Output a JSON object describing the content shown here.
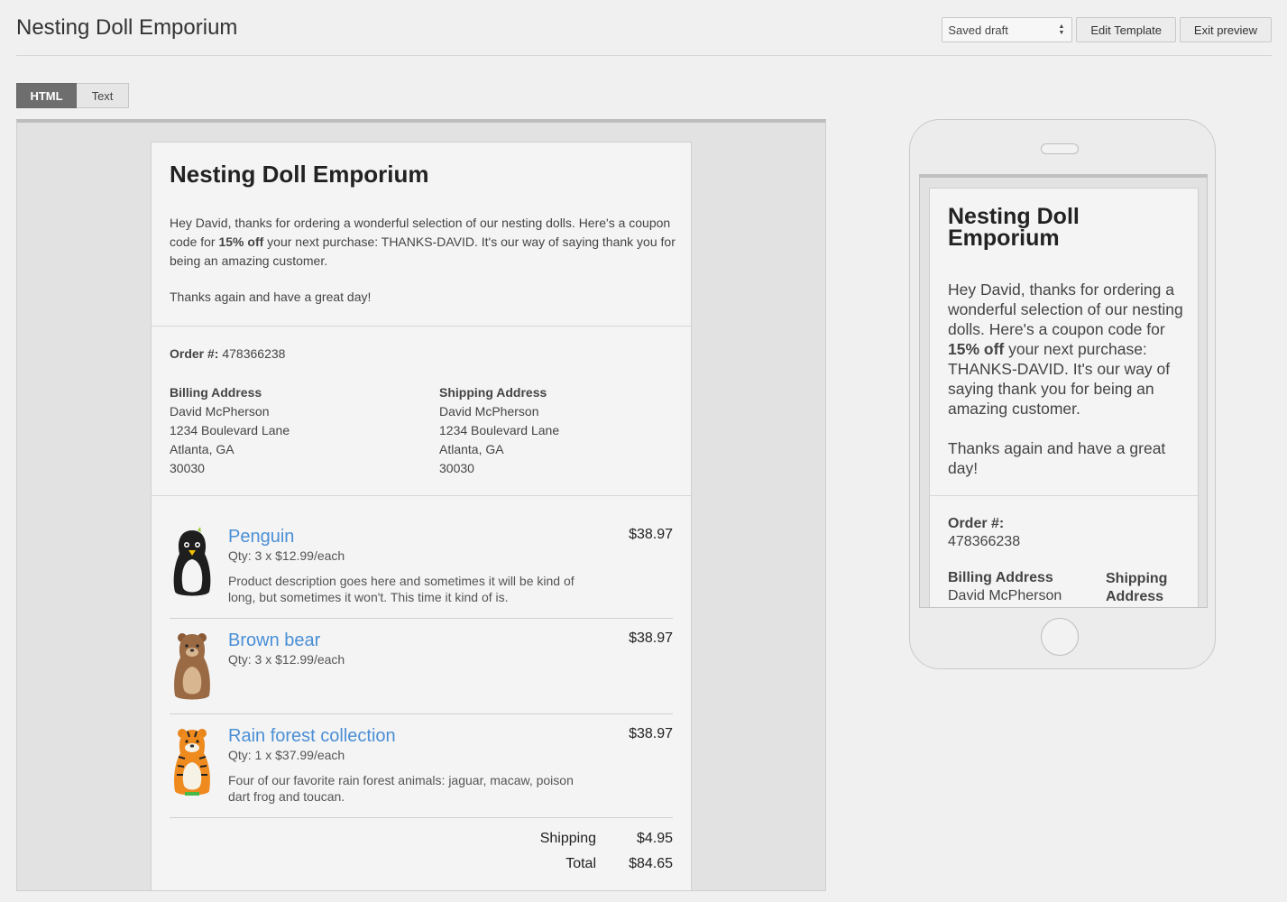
{
  "header": {
    "title": "Nesting Doll Emporium",
    "status_select": "Saved draft",
    "edit_template_label": "Edit Template",
    "exit_preview_label": "Exit preview"
  },
  "tabs": {
    "html_label": "HTML",
    "text_label": "Text",
    "active": "HTML"
  },
  "email": {
    "store_name": "Nesting Doll Emporium",
    "intro_before": "Hey David, thanks for ordering a wonderful selection of our nesting dolls. Here's a coupon code for ",
    "intro_bold": "15% off",
    "intro_after": " your next purchase: THANKS-DAVID. It's our way of saying thank you for being an amazing customer.",
    "thanks": "Thanks again and have a great day!",
    "order_label": "Order #:",
    "order_number": "478366238",
    "billing": {
      "heading": "Billing Address",
      "name": "David McPherson",
      "street": "1234 Boulevard Lane",
      "city": "Atlanta, GA",
      "zip": "30030"
    },
    "shipping": {
      "heading": "Shipping Address",
      "name": "David McPherson",
      "street": "1234 Boulevard Lane",
      "city": "Atlanta, GA",
      "zip": "30030"
    },
    "items": [
      {
        "name": "Penguin",
        "qty": "Qty: 3 x $12.99/each",
        "description": "Product description goes here and sometimes it will be kind of long, but sometimes it won't. This time it kind of is.",
        "price": "$38.97",
        "icon": "penguin-doll-icon"
      },
      {
        "name": "Brown bear",
        "qty": "Qty: 3 x $12.99/each",
        "description": "",
        "price": "$38.97",
        "icon": "bear-doll-icon"
      },
      {
        "name": "Rain forest collection",
        "qty": "Qty: 1 x $37.99/each",
        "description": "Four of our favorite rain forest animals: jaguar, macaw, poison dart frog and toucan.",
        "price": "$38.97",
        "icon": "tiger-doll-icon"
      }
    ],
    "shipping_label": "Shipping",
    "shipping_cost": "$4.95",
    "total_label": "Total",
    "total": "$84.65"
  },
  "colors": {
    "link": "#4a8fd6",
    "active_tab": "#6e6e6e"
  }
}
